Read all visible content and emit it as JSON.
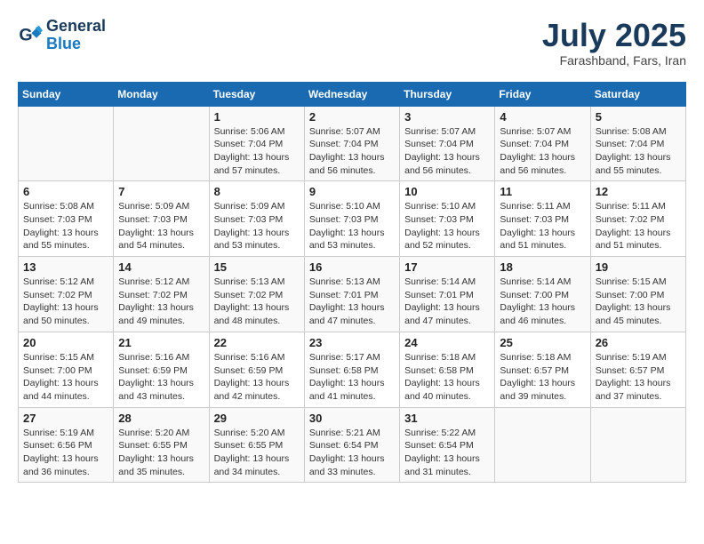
{
  "header": {
    "logo_line1": "General",
    "logo_line2": "Blue",
    "month": "July 2025",
    "location": "Farashband, Fars, Iran"
  },
  "days_of_week": [
    "Sunday",
    "Monday",
    "Tuesday",
    "Wednesday",
    "Thursday",
    "Friday",
    "Saturday"
  ],
  "weeks": [
    [
      {
        "day": "",
        "info": ""
      },
      {
        "day": "",
        "info": ""
      },
      {
        "day": "1",
        "info": "Sunrise: 5:06 AM\nSunset: 7:04 PM\nDaylight: 13 hours and 57 minutes."
      },
      {
        "day": "2",
        "info": "Sunrise: 5:07 AM\nSunset: 7:04 PM\nDaylight: 13 hours and 56 minutes."
      },
      {
        "day": "3",
        "info": "Sunrise: 5:07 AM\nSunset: 7:04 PM\nDaylight: 13 hours and 56 minutes."
      },
      {
        "day": "4",
        "info": "Sunrise: 5:07 AM\nSunset: 7:04 PM\nDaylight: 13 hours and 56 minutes."
      },
      {
        "day": "5",
        "info": "Sunrise: 5:08 AM\nSunset: 7:04 PM\nDaylight: 13 hours and 55 minutes."
      }
    ],
    [
      {
        "day": "6",
        "info": "Sunrise: 5:08 AM\nSunset: 7:03 PM\nDaylight: 13 hours and 55 minutes."
      },
      {
        "day": "7",
        "info": "Sunrise: 5:09 AM\nSunset: 7:03 PM\nDaylight: 13 hours and 54 minutes."
      },
      {
        "day": "8",
        "info": "Sunrise: 5:09 AM\nSunset: 7:03 PM\nDaylight: 13 hours and 53 minutes."
      },
      {
        "day": "9",
        "info": "Sunrise: 5:10 AM\nSunset: 7:03 PM\nDaylight: 13 hours and 53 minutes."
      },
      {
        "day": "10",
        "info": "Sunrise: 5:10 AM\nSunset: 7:03 PM\nDaylight: 13 hours and 52 minutes."
      },
      {
        "day": "11",
        "info": "Sunrise: 5:11 AM\nSunset: 7:03 PM\nDaylight: 13 hours and 51 minutes."
      },
      {
        "day": "12",
        "info": "Sunrise: 5:11 AM\nSunset: 7:02 PM\nDaylight: 13 hours and 51 minutes."
      }
    ],
    [
      {
        "day": "13",
        "info": "Sunrise: 5:12 AM\nSunset: 7:02 PM\nDaylight: 13 hours and 50 minutes."
      },
      {
        "day": "14",
        "info": "Sunrise: 5:12 AM\nSunset: 7:02 PM\nDaylight: 13 hours and 49 minutes."
      },
      {
        "day": "15",
        "info": "Sunrise: 5:13 AM\nSunset: 7:02 PM\nDaylight: 13 hours and 48 minutes."
      },
      {
        "day": "16",
        "info": "Sunrise: 5:13 AM\nSunset: 7:01 PM\nDaylight: 13 hours and 47 minutes."
      },
      {
        "day": "17",
        "info": "Sunrise: 5:14 AM\nSunset: 7:01 PM\nDaylight: 13 hours and 47 minutes."
      },
      {
        "day": "18",
        "info": "Sunrise: 5:14 AM\nSunset: 7:00 PM\nDaylight: 13 hours and 46 minutes."
      },
      {
        "day": "19",
        "info": "Sunrise: 5:15 AM\nSunset: 7:00 PM\nDaylight: 13 hours and 45 minutes."
      }
    ],
    [
      {
        "day": "20",
        "info": "Sunrise: 5:15 AM\nSunset: 7:00 PM\nDaylight: 13 hours and 44 minutes."
      },
      {
        "day": "21",
        "info": "Sunrise: 5:16 AM\nSunset: 6:59 PM\nDaylight: 13 hours and 43 minutes."
      },
      {
        "day": "22",
        "info": "Sunrise: 5:16 AM\nSunset: 6:59 PM\nDaylight: 13 hours and 42 minutes."
      },
      {
        "day": "23",
        "info": "Sunrise: 5:17 AM\nSunset: 6:58 PM\nDaylight: 13 hours and 41 minutes."
      },
      {
        "day": "24",
        "info": "Sunrise: 5:18 AM\nSunset: 6:58 PM\nDaylight: 13 hours and 40 minutes."
      },
      {
        "day": "25",
        "info": "Sunrise: 5:18 AM\nSunset: 6:57 PM\nDaylight: 13 hours and 39 minutes."
      },
      {
        "day": "26",
        "info": "Sunrise: 5:19 AM\nSunset: 6:57 PM\nDaylight: 13 hours and 37 minutes."
      }
    ],
    [
      {
        "day": "27",
        "info": "Sunrise: 5:19 AM\nSunset: 6:56 PM\nDaylight: 13 hours and 36 minutes."
      },
      {
        "day": "28",
        "info": "Sunrise: 5:20 AM\nSunset: 6:55 PM\nDaylight: 13 hours and 35 minutes."
      },
      {
        "day": "29",
        "info": "Sunrise: 5:20 AM\nSunset: 6:55 PM\nDaylight: 13 hours and 34 minutes."
      },
      {
        "day": "30",
        "info": "Sunrise: 5:21 AM\nSunset: 6:54 PM\nDaylight: 13 hours and 33 minutes."
      },
      {
        "day": "31",
        "info": "Sunrise: 5:22 AM\nSunset: 6:54 PM\nDaylight: 13 hours and 31 minutes."
      },
      {
        "day": "",
        "info": ""
      },
      {
        "day": "",
        "info": ""
      }
    ]
  ]
}
